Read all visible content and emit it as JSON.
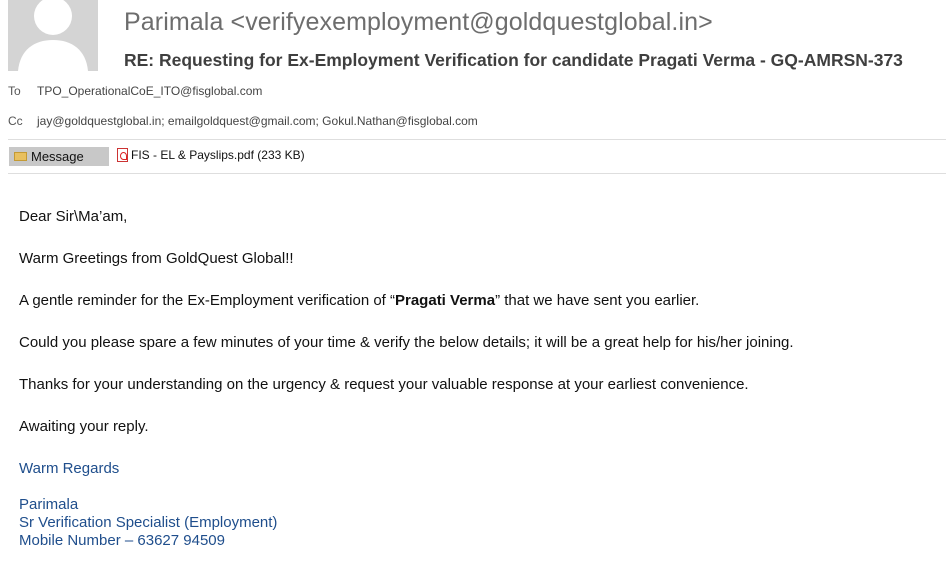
{
  "email": {
    "sender": "Parimala <verifyexemployment@goldquestglobal.in>",
    "subject": "RE: Requesting for Ex-Employment Verification for candidate Pragati Verma - GQ-AMRSN-373",
    "to_label": "To",
    "to": "TPO_OperationalCoE_ITO@fisglobal.com",
    "cc_label": "Cc",
    "cc": "jay@goldquestglobal.in; emailgoldquest@gmail.com; Gokul.Nathan@fisglobal.com"
  },
  "tabs": {
    "message_label": "Message",
    "attachment": "FIS - EL & Payslips.pdf (233 KB)"
  },
  "body": {
    "greeting": "Dear Sir\\Ma’am,",
    "warm": "Warm Greetings from GoldQuest Global!!",
    "reminder_pre": "A gentle reminder for the Ex-Employment verification of “",
    "candidate": "Pragati Verma",
    "reminder_post": "” that we have sent you earlier.",
    "request": "Could you please spare a few minutes of your time & verify the below details; it will be a great  help for his/her joining.",
    "thanks": "Thanks for your understanding on the urgency & request your valuable response at your earliest convenience.",
    "awaiting": "Awaiting your reply."
  },
  "signature": {
    "regards": "Warm Regards",
    "name": "Parimala",
    "title": "Sr Verification Specialist (Employment)",
    "mobile": "Mobile Number – 63627 94509"
  },
  "icons": {
    "avatar": "person-silhouette-icon",
    "message": "envelope-icon",
    "attachment": "pdf-file-icon"
  },
  "colors": {
    "signature": "#1f4e8c",
    "sender": "#6d6d6d"
  }
}
